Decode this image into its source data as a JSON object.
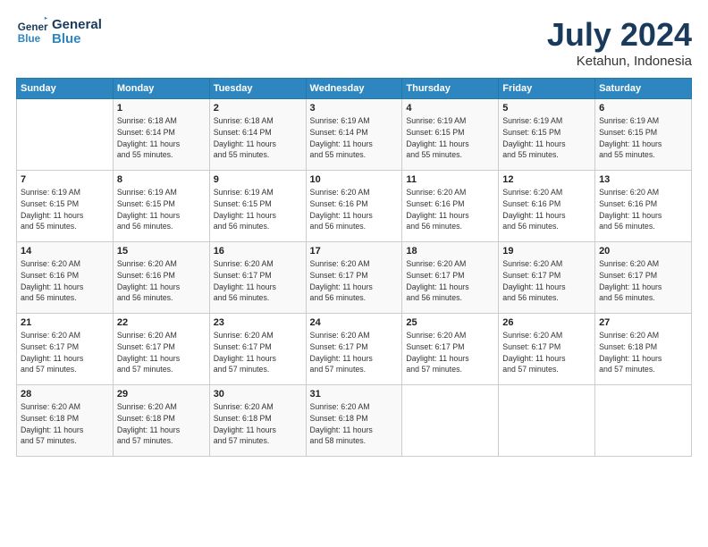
{
  "logo": {
    "line1": "General",
    "line2": "Blue"
  },
  "title": "July 2024",
  "location": "Ketahun, Indonesia",
  "weekdays": [
    "Sunday",
    "Monday",
    "Tuesday",
    "Wednesday",
    "Thursday",
    "Friday",
    "Saturday"
  ],
  "weeks": [
    [
      {
        "day": "",
        "info": ""
      },
      {
        "day": "1",
        "info": "Sunrise: 6:18 AM\nSunset: 6:14 PM\nDaylight: 11 hours\nand 55 minutes."
      },
      {
        "day": "2",
        "info": "Sunrise: 6:18 AM\nSunset: 6:14 PM\nDaylight: 11 hours\nand 55 minutes."
      },
      {
        "day": "3",
        "info": "Sunrise: 6:19 AM\nSunset: 6:14 PM\nDaylight: 11 hours\nand 55 minutes."
      },
      {
        "day": "4",
        "info": "Sunrise: 6:19 AM\nSunset: 6:15 PM\nDaylight: 11 hours\nand 55 minutes."
      },
      {
        "day": "5",
        "info": "Sunrise: 6:19 AM\nSunset: 6:15 PM\nDaylight: 11 hours\nand 55 minutes."
      },
      {
        "day": "6",
        "info": "Sunrise: 6:19 AM\nSunset: 6:15 PM\nDaylight: 11 hours\nand 55 minutes."
      }
    ],
    [
      {
        "day": "7",
        "info": "Sunrise: 6:19 AM\nSunset: 6:15 PM\nDaylight: 11 hours\nand 55 minutes."
      },
      {
        "day": "8",
        "info": "Sunrise: 6:19 AM\nSunset: 6:15 PM\nDaylight: 11 hours\nand 56 minutes."
      },
      {
        "day": "9",
        "info": "Sunrise: 6:19 AM\nSunset: 6:15 PM\nDaylight: 11 hours\nand 56 minutes."
      },
      {
        "day": "10",
        "info": "Sunrise: 6:20 AM\nSunset: 6:16 PM\nDaylight: 11 hours\nand 56 minutes."
      },
      {
        "day": "11",
        "info": "Sunrise: 6:20 AM\nSunset: 6:16 PM\nDaylight: 11 hours\nand 56 minutes."
      },
      {
        "day": "12",
        "info": "Sunrise: 6:20 AM\nSunset: 6:16 PM\nDaylight: 11 hours\nand 56 minutes."
      },
      {
        "day": "13",
        "info": "Sunrise: 6:20 AM\nSunset: 6:16 PM\nDaylight: 11 hours\nand 56 minutes."
      }
    ],
    [
      {
        "day": "14",
        "info": "Sunrise: 6:20 AM\nSunset: 6:16 PM\nDaylight: 11 hours\nand 56 minutes."
      },
      {
        "day": "15",
        "info": "Sunrise: 6:20 AM\nSunset: 6:16 PM\nDaylight: 11 hours\nand 56 minutes."
      },
      {
        "day": "16",
        "info": "Sunrise: 6:20 AM\nSunset: 6:17 PM\nDaylight: 11 hours\nand 56 minutes."
      },
      {
        "day": "17",
        "info": "Sunrise: 6:20 AM\nSunset: 6:17 PM\nDaylight: 11 hours\nand 56 minutes."
      },
      {
        "day": "18",
        "info": "Sunrise: 6:20 AM\nSunset: 6:17 PM\nDaylight: 11 hours\nand 56 minutes."
      },
      {
        "day": "19",
        "info": "Sunrise: 6:20 AM\nSunset: 6:17 PM\nDaylight: 11 hours\nand 56 minutes."
      },
      {
        "day": "20",
        "info": "Sunrise: 6:20 AM\nSunset: 6:17 PM\nDaylight: 11 hours\nand 56 minutes."
      }
    ],
    [
      {
        "day": "21",
        "info": "Sunrise: 6:20 AM\nSunset: 6:17 PM\nDaylight: 11 hours\nand 57 minutes."
      },
      {
        "day": "22",
        "info": "Sunrise: 6:20 AM\nSunset: 6:17 PM\nDaylight: 11 hours\nand 57 minutes."
      },
      {
        "day": "23",
        "info": "Sunrise: 6:20 AM\nSunset: 6:17 PM\nDaylight: 11 hours\nand 57 minutes."
      },
      {
        "day": "24",
        "info": "Sunrise: 6:20 AM\nSunset: 6:17 PM\nDaylight: 11 hours\nand 57 minutes."
      },
      {
        "day": "25",
        "info": "Sunrise: 6:20 AM\nSunset: 6:17 PM\nDaylight: 11 hours\nand 57 minutes."
      },
      {
        "day": "26",
        "info": "Sunrise: 6:20 AM\nSunset: 6:17 PM\nDaylight: 11 hours\nand 57 minutes."
      },
      {
        "day": "27",
        "info": "Sunrise: 6:20 AM\nSunset: 6:18 PM\nDaylight: 11 hours\nand 57 minutes."
      }
    ],
    [
      {
        "day": "28",
        "info": "Sunrise: 6:20 AM\nSunset: 6:18 PM\nDaylight: 11 hours\nand 57 minutes."
      },
      {
        "day": "29",
        "info": "Sunrise: 6:20 AM\nSunset: 6:18 PM\nDaylight: 11 hours\nand 57 minutes."
      },
      {
        "day": "30",
        "info": "Sunrise: 6:20 AM\nSunset: 6:18 PM\nDaylight: 11 hours\nand 57 minutes."
      },
      {
        "day": "31",
        "info": "Sunrise: 6:20 AM\nSunset: 6:18 PM\nDaylight: 11 hours\nand 58 minutes."
      },
      {
        "day": "",
        "info": ""
      },
      {
        "day": "",
        "info": ""
      },
      {
        "day": "",
        "info": ""
      }
    ]
  ]
}
